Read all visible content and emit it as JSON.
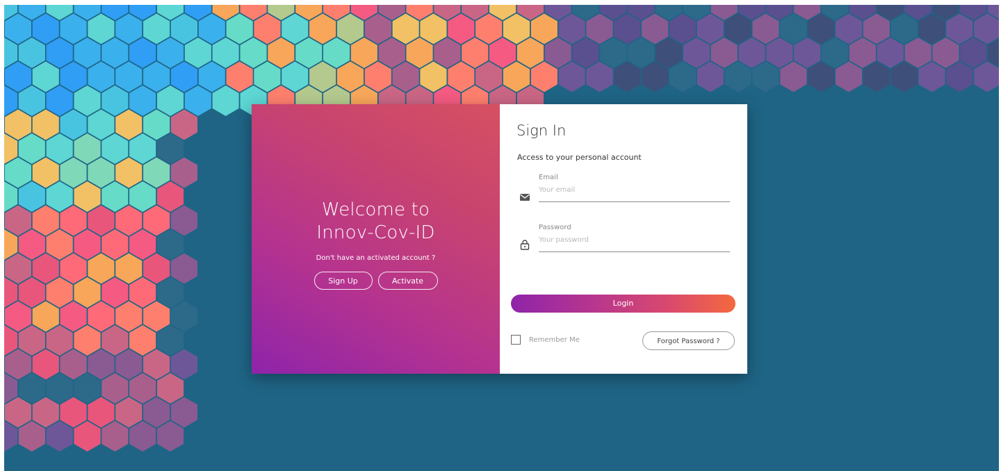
{
  "welcome": {
    "title_line1": "Welcome to",
    "title_line2": "Innov-Cov-ID",
    "subtitle": "Don't have an activated account ?",
    "signup_label": "Sign Up",
    "activate_label": "Activate"
  },
  "signin": {
    "title": "Sign In",
    "subtitle": "Access to your personal account",
    "email_label": "Email",
    "email_placeholder": "Your email",
    "email_icon": "mail-icon",
    "password_label": "Password",
    "password_placeholder": "Your password",
    "password_icon": "lock-icon",
    "login_label": "Login",
    "remember_label": "Remember Me",
    "remember_checked": false,
    "forgot_label": "Forgot Password ?"
  },
  "colors": {
    "background": "#1f6485",
    "gradient_start": "#8e24aa",
    "gradient_end": "#f4693e"
  }
}
